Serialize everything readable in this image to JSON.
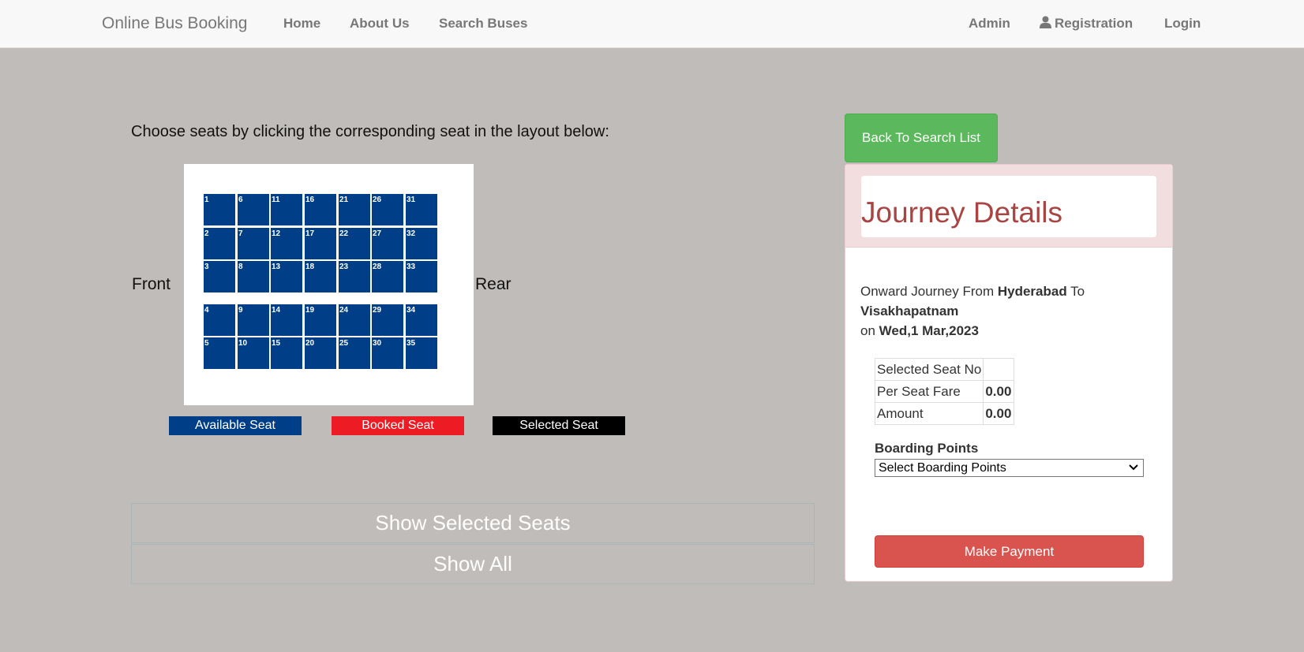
{
  "navbar": {
    "brand": "Online Bus Booking",
    "home": "Home",
    "about": "About Us",
    "search": "Search Buses",
    "admin": "Admin",
    "registration": "Registration",
    "login": "Login"
  },
  "seat_layout": {
    "instructions": "Choose seats by clicking the corresponding seat in the layout below:",
    "front_label": "Front",
    "rear_label": "Rear",
    "available_color": "#003f87",
    "seats": [
      "1",
      "2",
      "3",
      "4",
      "5",
      "6",
      "7",
      "8",
      "9",
      "10",
      "11",
      "12",
      "13",
      "14",
      "15",
      "16",
      "17",
      "18",
      "19",
      "20",
      "21",
      "22",
      "23",
      "24",
      "25",
      "26",
      "27",
      "28",
      "29",
      "30",
      "31",
      "32",
      "33",
      "34",
      "35"
    ]
  },
  "legend": {
    "available": "Available Seat",
    "booked": "Booked Seat",
    "selected": "Selected Seat",
    "available_color": "#003f87",
    "booked_color": "#ed1c24",
    "selected_color": "#000000"
  },
  "actions": {
    "show_selected": "Show Selected Seats",
    "show_all": "Show All"
  },
  "journey": {
    "back_button": "Back To Search List",
    "title": "Journey Details",
    "onward_prefix": "Onward Journey From",
    "from": "Hyderabad",
    "to_word": "To",
    "to": "Visakhapatnam",
    "on_word": "on",
    "date": "Wed,1 Mar,2023",
    "fare_table": {
      "selected_seat_label": "Selected Seat No",
      "selected_seat_value": "",
      "per_seat_fare_label": "Per Seat Fare",
      "per_seat_fare_value": "0.00",
      "amount_label": "Amount",
      "amount_value": "0.00"
    },
    "boarding_label": "Boarding Points",
    "boarding_selected": "Select Boarding Points",
    "pay_button": "Make Payment"
  }
}
